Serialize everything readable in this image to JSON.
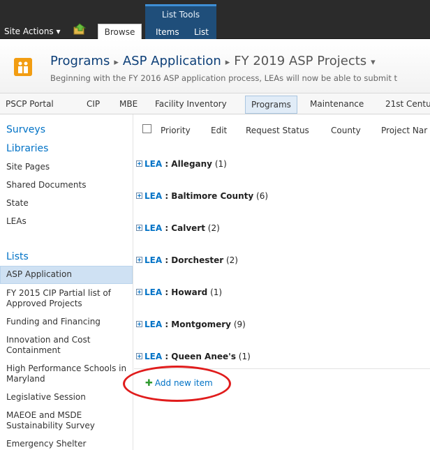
{
  "ribbon": {
    "site_actions": "Site Actions ▾",
    "browse": "Browse",
    "list_tools": "List Tools",
    "items": "Items",
    "list": "List"
  },
  "title": {
    "crumb1": "Programs",
    "crumb2": "ASP Application",
    "crumb3": "FY 2019 ASP Projects",
    "description": "Beginning with the FY 2016 ASP application process, LEAs will now be able to submit t"
  },
  "topnav": {
    "tabs": [
      "PSCP Portal",
      "CIP",
      "MBE",
      "Facility Inventory",
      "Programs",
      "Maintenance",
      "21st Centu"
    ]
  },
  "leftnav": {
    "surveys": "Surveys",
    "libraries": "Libraries",
    "site_pages": "Site Pages",
    "shared_documents": "Shared Documents",
    "state": "State",
    "leas": "LEAs",
    "lists": "Lists",
    "asp_application": "ASP Application",
    "fy2015_cip": "FY 2015 CIP Partial list of Approved Projects",
    "funding": "Funding and Financing",
    "innovation": "Innovation and Cost Containment",
    "high_performance": "High Performance Schools in Maryland",
    "legislative": "Legislative Session",
    "maeoe": "MAEOE and MSDE Sustainability Survey",
    "emergency": "Emergency Shelter"
  },
  "columns": {
    "priority": "Priority",
    "edit": "Edit",
    "request_status": "Request Status",
    "county": "County",
    "project_name": "Project Nar"
  },
  "groups": [
    {
      "label": "LEA",
      "name": "Allegany",
      "count": "(1)"
    },
    {
      "label": "LEA",
      "name": "Baltimore County",
      "count": "(6)"
    },
    {
      "label": "LEA",
      "name": "Calvert",
      "count": "(2)"
    },
    {
      "label": "LEA",
      "name": "Dorchester",
      "count": "(2)"
    },
    {
      "label": "LEA",
      "name": "Howard",
      "count": "(1)"
    },
    {
      "label": "LEA",
      "name": "Montgomery",
      "count": "(9)"
    },
    {
      "label": "LEA",
      "name": "Queen Anee's",
      "count": "(1)"
    }
  ],
  "add_new_item": "Add new item",
  "colors": {
    "link_blue": "#0072c6",
    "ribbon_dark": "#2b2b2b",
    "list_tools_blue": "#1f4e7a",
    "highlight_red": "#e01c1c",
    "site_icon_orange": "#f29d12"
  }
}
